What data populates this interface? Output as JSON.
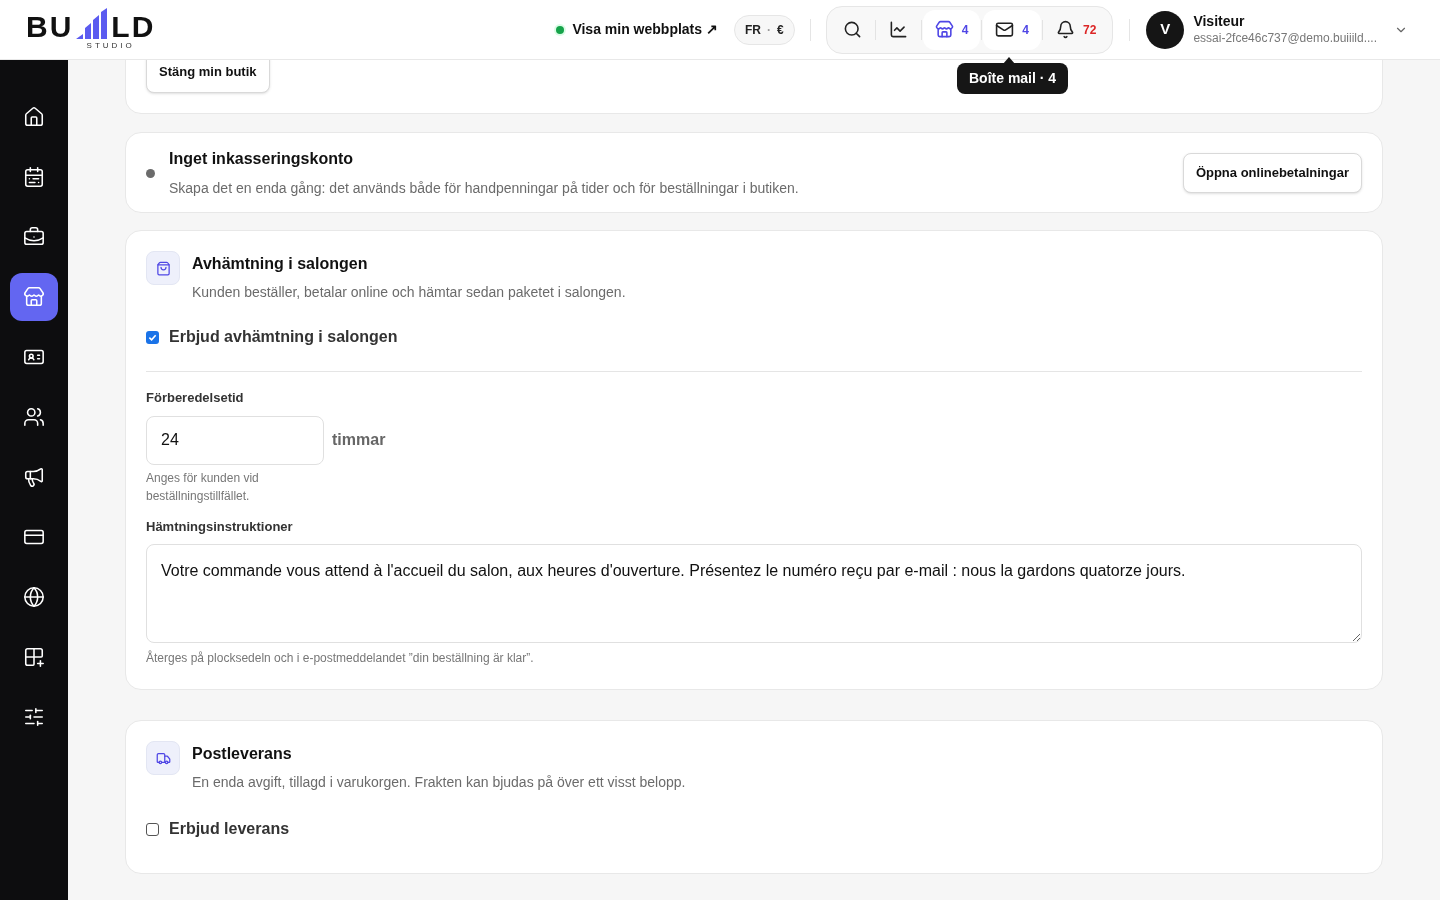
{
  "logo": {
    "left": "BU",
    "right": "LD",
    "sub": "STUDIO"
  },
  "header": {
    "site_link": "Visa min webbplats ↗",
    "locale": {
      "lang": "FR",
      "separator": "·",
      "currency": "€"
    },
    "toolbar": [
      {
        "kind": "search",
        "selected": false
      },
      {
        "kind": "stats",
        "selected": false
      },
      {
        "kind": "store",
        "count": "4",
        "selected": true
      },
      {
        "kind": "mail",
        "count": "4",
        "selected": false,
        "hovered": true
      },
      {
        "kind": "bell",
        "count": "72",
        "selected": false
      }
    ],
    "tooltip": "Boîte mail · 4",
    "user": {
      "initial": "V",
      "name": "Visiteur",
      "email": "essai-2fce46c737@demo.buiiild...."
    }
  },
  "sidebar": {
    "items": [
      {
        "kind": "home",
        "selected": false
      },
      {
        "kind": "calendar",
        "selected": false
      },
      {
        "kind": "briefcase",
        "selected": false
      },
      {
        "kind": "store",
        "selected": true
      },
      {
        "kind": "contact",
        "selected": false
      },
      {
        "kind": "users",
        "selected": false
      },
      {
        "kind": "megaphone",
        "selected": false
      },
      {
        "kind": "card",
        "selected": false
      },
      {
        "kind": "globe",
        "selected": false
      },
      {
        "kind": "apps",
        "selected": false
      },
      {
        "kind": "sliders",
        "selected": false
      }
    ]
  },
  "top_card": {
    "button": "Stäng min butik"
  },
  "payment_card": {
    "title": "Inget inkasseringskonto",
    "text": "Skapa det en enda gång: det används både för handpenningar på tider och för beställningar i butiken.",
    "button": "Öppna onlinebetalningar"
  },
  "pickup": {
    "title": "Avhämtning i salongen",
    "text": "Kunden beställer, betalar online och hämtar sedan paketet i salongen.",
    "checkbox": {
      "label": "Erbjud avhämtning i salongen",
      "checked": true
    },
    "prep": {
      "label": "Förberedelsetid",
      "value": "24",
      "unit": "timmar",
      "hint": "Anges för kunden vid beställningstillfället."
    },
    "instructions": {
      "label": "Hämtningsinstruktioner",
      "value": "Votre commande vous attend à l'accueil du salon, aux heures d'ouverture. Présentez le numéro reçu par e-mail : nous la gardons quatorze jours.",
      "hint": "Återges på plocksedeln och i e-postmeddelandet ”din beställning är klar”."
    }
  },
  "delivery": {
    "title": "Postleverans",
    "text": "En enda avgift, tillagd i varukorgen. Frakten kan bjudas på över ett visst belopp.",
    "checkbox": {
      "label": "Erbjud leverans",
      "checked": false
    }
  }
}
